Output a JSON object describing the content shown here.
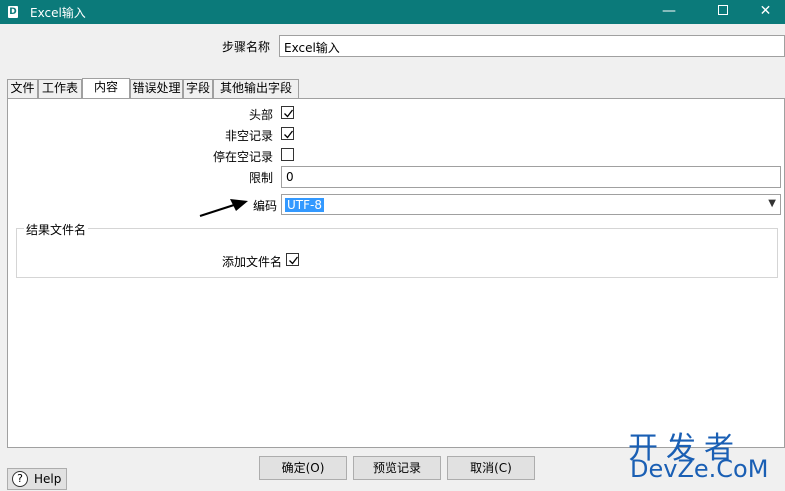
{
  "window": {
    "title": "Excel输入",
    "icon": "kettle-app-icon",
    "minimize": "—",
    "close": "✕"
  },
  "step_name": {
    "label": "步骤名称",
    "value": "Excel输入"
  },
  "tabs": [
    {
      "label": "文件"
    },
    {
      "label": "工作表"
    },
    {
      "label": "内容"
    },
    {
      "label": "错误处理"
    },
    {
      "label": "字段"
    },
    {
      "label": "其他输出字段"
    }
  ],
  "content": {
    "header": {
      "label": "头部",
      "checked": true
    },
    "non_empty": {
      "label": "非空记录",
      "checked": true
    },
    "stop_on_empty": {
      "label": "停在空记录",
      "checked": false
    },
    "limit": {
      "label": "限制",
      "value": "0"
    },
    "encoding": {
      "label": "编码",
      "value": "UTF-8"
    }
  },
  "result_group": {
    "title": "结果文件名",
    "add_filename": {
      "label": "添加文件名",
      "checked": true
    }
  },
  "buttons": {
    "ok": "确定(O)",
    "preview": "预览记录",
    "cancel": "取消(C)",
    "help": "Help"
  },
  "watermark": {
    "line1": "开发者",
    "line2": "DevZe.CoM"
  },
  "colors": {
    "titlebar": "#0b7a7a",
    "selection": "#3399ff",
    "watermark": "#1a5fb4"
  }
}
